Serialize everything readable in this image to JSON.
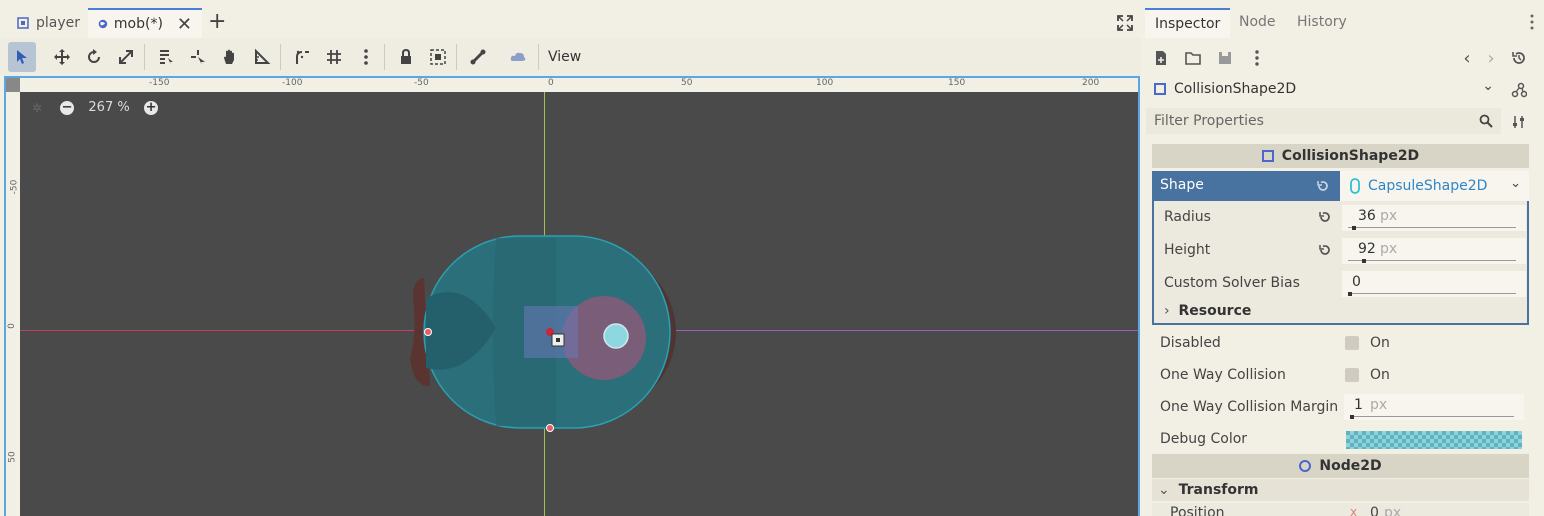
{
  "scene_tabs": [
    {
      "label": "player",
      "active": false,
      "icon": "scene-2d-icon"
    },
    {
      "label": "mob(*)",
      "active": true,
      "icon": "globe-icon"
    }
  ],
  "toolbar": {
    "view_label": "View"
  },
  "viewport": {
    "zoom_label": "267 %",
    "ruler_top": [
      "-150",
      "-100",
      "-50",
      "0",
      "50",
      "100",
      "150",
      "200"
    ],
    "ruler_left": [
      "-50",
      "0",
      "50"
    ]
  },
  "inspector": {
    "tabs": [
      "Inspector",
      "Node",
      "History"
    ],
    "node_name": "CollisionShape2D",
    "filter_placeholder": "Filter Properties",
    "section_title": "CollisionShape2D",
    "shape": {
      "label": "Shape",
      "value": "CapsuleShape2D"
    },
    "capsule": {
      "radius": {
        "label": "Radius",
        "value": "36",
        "unit": "px"
      },
      "height": {
        "label": "Height",
        "value": "92",
        "unit": "px"
      },
      "bias": {
        "label": "Custom Solver Bias",
        "value": "0"
      },
      "resource_label": "Resource"
    },
    "disabled": {
      "label": "Disabled",
      "value": "On"
    },
    "one_way": {
      "label": "One Way Collision",
      "value": "On"
    },
    "one_way_margin": {
      "label": "One Way Collision Margin",
      "value": "1",
      "unit": "px"
    },
    "debug_color": {
      "label": "Debug Color",
      "color": "#5fb3c0"
    },
    "node2d_title": "Node2D",
    "transform_label": "Transform",
    "position_label": "Position",
    "position_value": "0",
    "position_unit": "px"
  },
  "colors": {
    "accent": "#4b7fd6",
    "selected_row": "#4872a0",
    "viewport_bg": "#4a4a4a",
    "collision": "#2aa0b0"
  }
}
